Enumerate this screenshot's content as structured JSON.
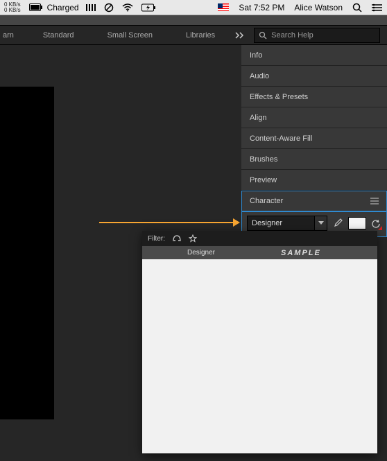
{
  "menubar": {
    "netspeed_up": "0 KB/s",
    "netspeed_down": "0 KB/s",
    "battery_label": "Charged",
    "datetime": "Sat 7:52 PM",
    "username": "Alice Watson"
  },
  "tabs": {
    "cut": "arn",
    "standard": "Standard",
    "small_screen": "Small Screen",
    "libraries": "Libraries"
  },
  "search": {
    "placeholder": "Search Help"
  },
  "panels": [
    {
      "label": "Info"
    },
    {
      "label": "Audio"
    },
    {
      "label": "Effects & Presets"
    },
    {
      "label": "Align"
    },
    {
      "label": "Content-Aware Fill"
    },
    {
      "label": "Brushes"
    },
    {
      "label": "Preview"
    }
  ],
  "character": {
    "title": "Character",
    "font_value": "Designer"
  },
  "colors": {
    "swatch": "#f5f5f5"
  },
  "fontpop": {
    "filter_label": "Filter:",
    "col_name": "Designer",
    "col_sample": "SAMPLE"
  }
}
